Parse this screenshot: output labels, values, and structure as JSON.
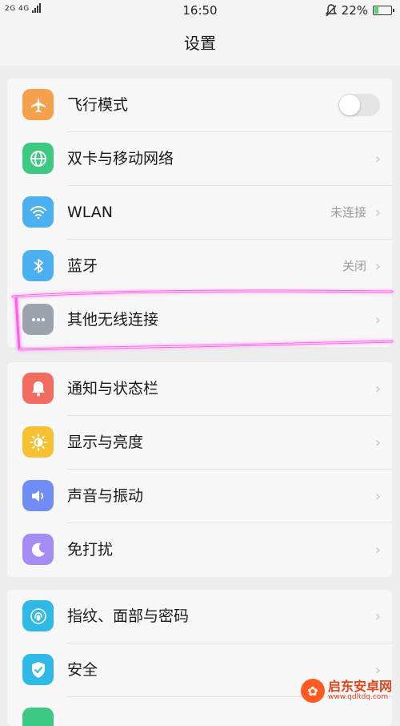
{
  "status_bar": {
    "network": "2G 4G",
    "time": "16:50",
    "battery_percent": "22%",
    "battery_level": 0.22
  },
  "header": {
    "title": "设置"
  },
  "group1": [
    {
      "label": "飞行模式",
      "icon": "airplane-icon",
      "color": "#f5a04a",
      "toggle_on": false
    },
    {
      "label": "双卡与移动网络",
      "icon": "globe-icon",
      "color": "#3ec983"
    },
    {
      "label": "WLAN",
      "icon": "wifi-icon",
      "color": "#4bb0ef",
      "value": "未连接"
    },
    {
      "label": "蓝牙",
      "icon": "bluetooth-icon",
      "color": "#4bb0ef",
      "value": "关闭"
    },
    {
      "label": "其他无线连接",
      "icon": "more-icon",
      "color": "#9ca3ad"
    }
  ],
  "group2": [
    {
      "label": "通知与状态栏",
      "icon": "notification-icon",
      "color": "#f26c5f"
    },
    {
      "label": "显示与亮度",
      "icon": "brightness-icon",
      "color": "#f5c032"
    },
    {
      "label": "声音与振动",
      "icon": "sound-icon",
      "color": "#6f8df4"
    },
    {
      "label": "免打扰",
      "icon": "moon-icon",
      "color": "#a48cf5"
    }
  ],
  "group3": [
    {
      "label": "指纹、面部与密码",
      "icon": "fingerprint-icon",
      "color": "#2fb9e6"
    },
    {
      "label": "安全",
      "icon": "shield-icon",
      "color": "#2fb9e6"
    }
  ],
  "chevron": "›",
  "watermark": {
    "title": "启东安卓网",
    "subtitle": "www.qdltdq.com"
  }
}
